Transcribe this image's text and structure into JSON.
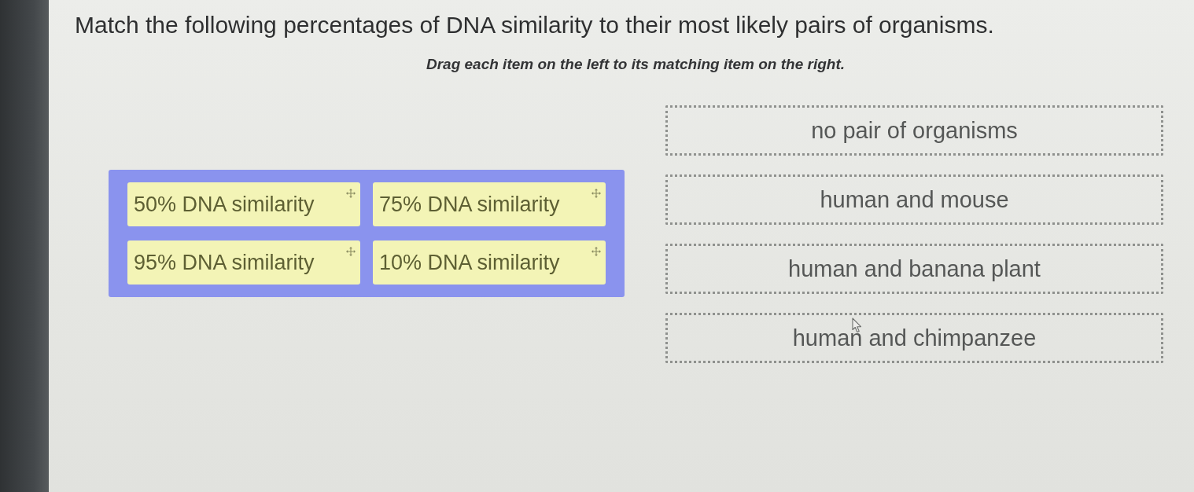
{
  "question": {
    "prompt": "Match the following percentages of DNA similarity to their most likely pairs of organisms.",
    "instruction": "Drag each item on the left to its matching item on the right."
  },
  "choices": [
    {
      "label": "50% DNA similarity"
    },
    {
      "label": "75% DNA similarity"
    },
    {
      "label": "95% DNA similarity"
    },
    {
      "label": "10% DNA similarity"
    }
  ],
  "targets": [
    {
      "label": "no pair of organisms"
    },
    {
      "label": "human and mouse"
    },
    {
      "label": "human and banana plant"
    },
    {
      "label": "human and chimpanzee"
    }
  ]
}
